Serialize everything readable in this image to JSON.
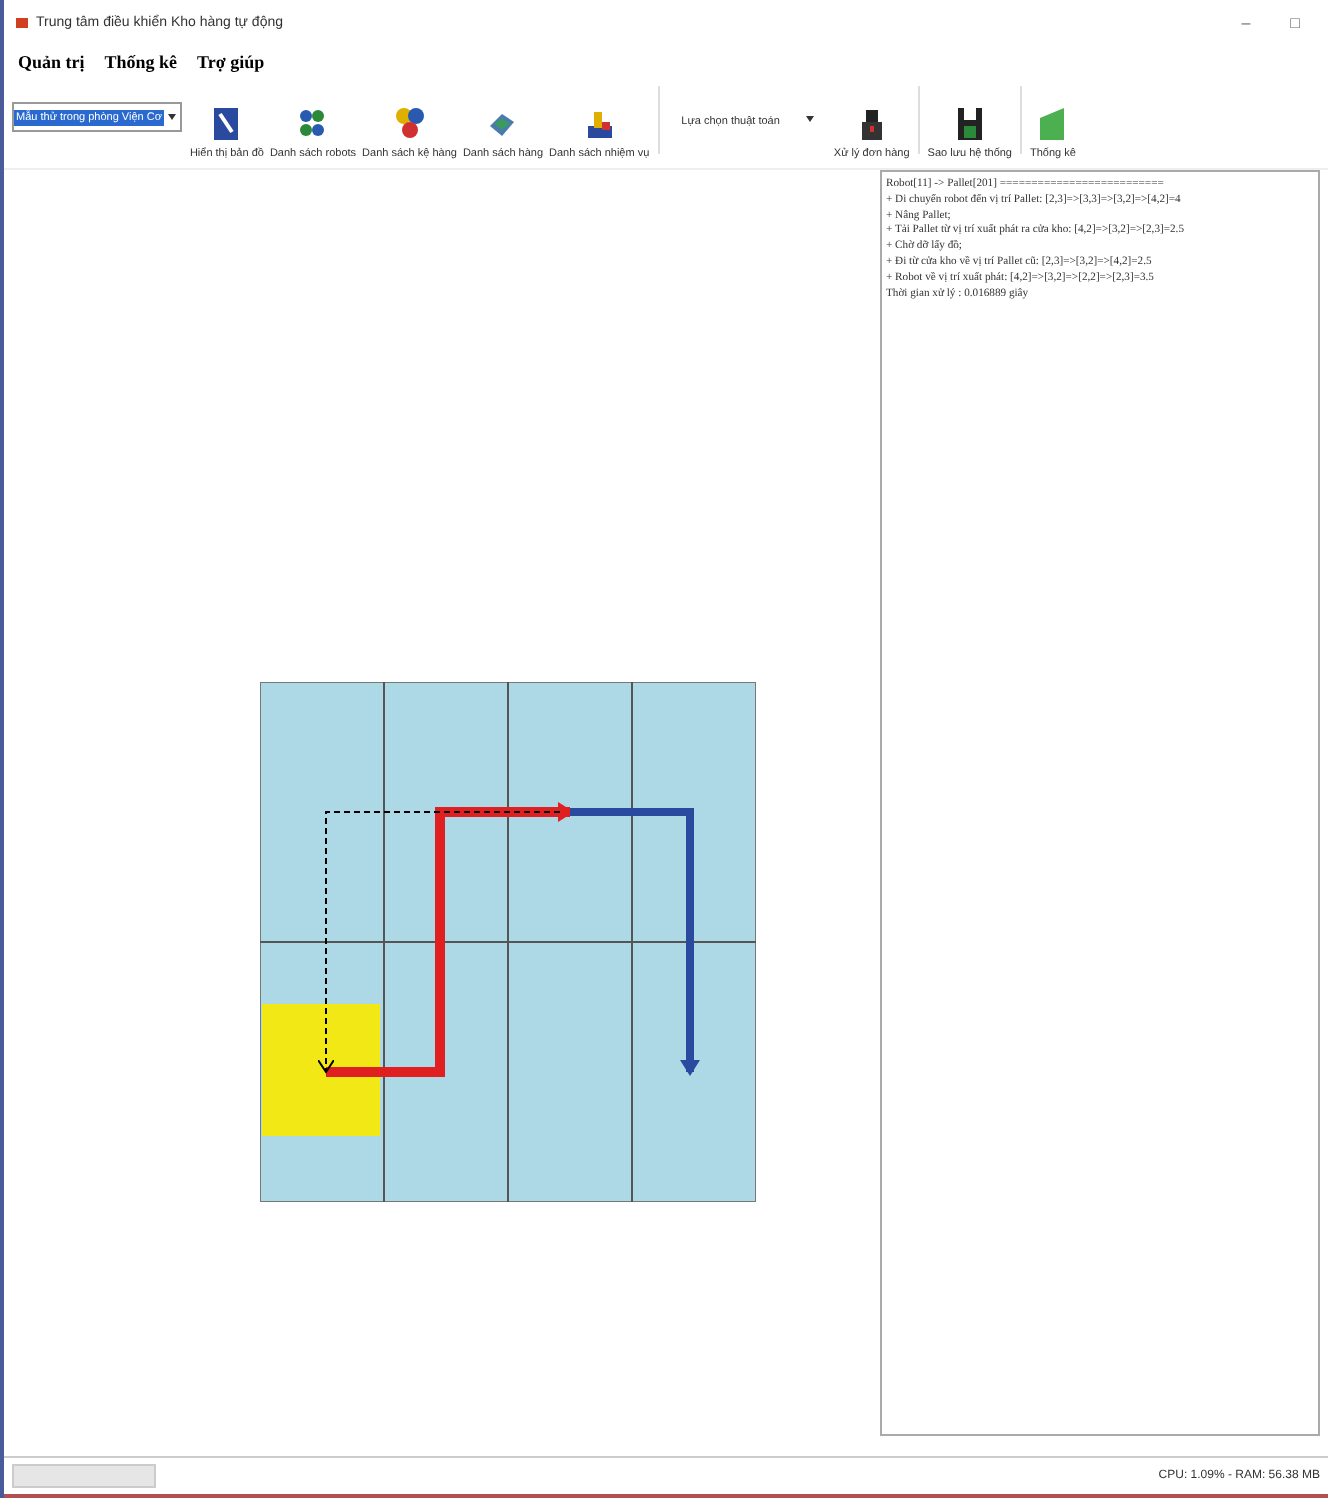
{
  "window": {
    "title": "Trung tâm điều khiển Kho hàng tự động",
    "controls": [
      "–",
      "□"
    ]
  },
  "menu": [
    "Quản trị",
    "Thống kê",
    "Trợ giúp"
  ],
  "toolbar": {
    "map_select": {
      "value": "Mẫu thử trong phòng Viện Cơ"
    },
    "items": [
      {
        "kind": "button",
        "label": "Hiển thị bản đồ"
      },
      {
        "kind": "button",
        "label": "Danh sách robots"
      },
      {
        "kind": "button",
        "label": "Danh sách kệ hàng"
      },
      {
        "kind": "button",
        "label": "Danh sách hàng"
      },
      {
        "kind": "button",
        "label": "Danh sách nhiệm vụ"
      },
      {
        "kind": "dropdown",
        "label": "Lựa chọn thuật toán"
      },
      {
        "kind": "button",
        "label": "Xử lý đơn hàng"
      },
      {
        "kind": "button",
        "label": "Sao lưu hệ thống"
      },
      {
        "kind": "button",
        "label": "Thống kê"
      }
    ]
  },
  "log": [
    "Robot[11] -> Pallet[201] ==========================",
    "+ Di chuyển robot đến vị trí Pallet: [2,3]=>[3,3]=>[3,2]=>[4,2]=4",
    "+ Nâng Pallet;",
    "+ Tải Pallet từ vị trí xuất phát ra cửa kho: [4,2]=>[3,2]=>[2,3]=2.5",
    "+ Chờ dỡ lấy đồ;",
    "+ Đi từ cửa kho về vị trí Pallet cũ: [2,3]=>[3,2]=>[4,2]=2.5",
    "+ Robot về vị trí xuất phát: [4,2]=>[3,2]=>[2,2]=>[2,3]=3.5",
    "Thời gian xử lý : 0.016889 giây"
  ],
  "status_bar": {
    "text": "CPU: 1.09% - RAM: 56.38 MB"
  }
}
